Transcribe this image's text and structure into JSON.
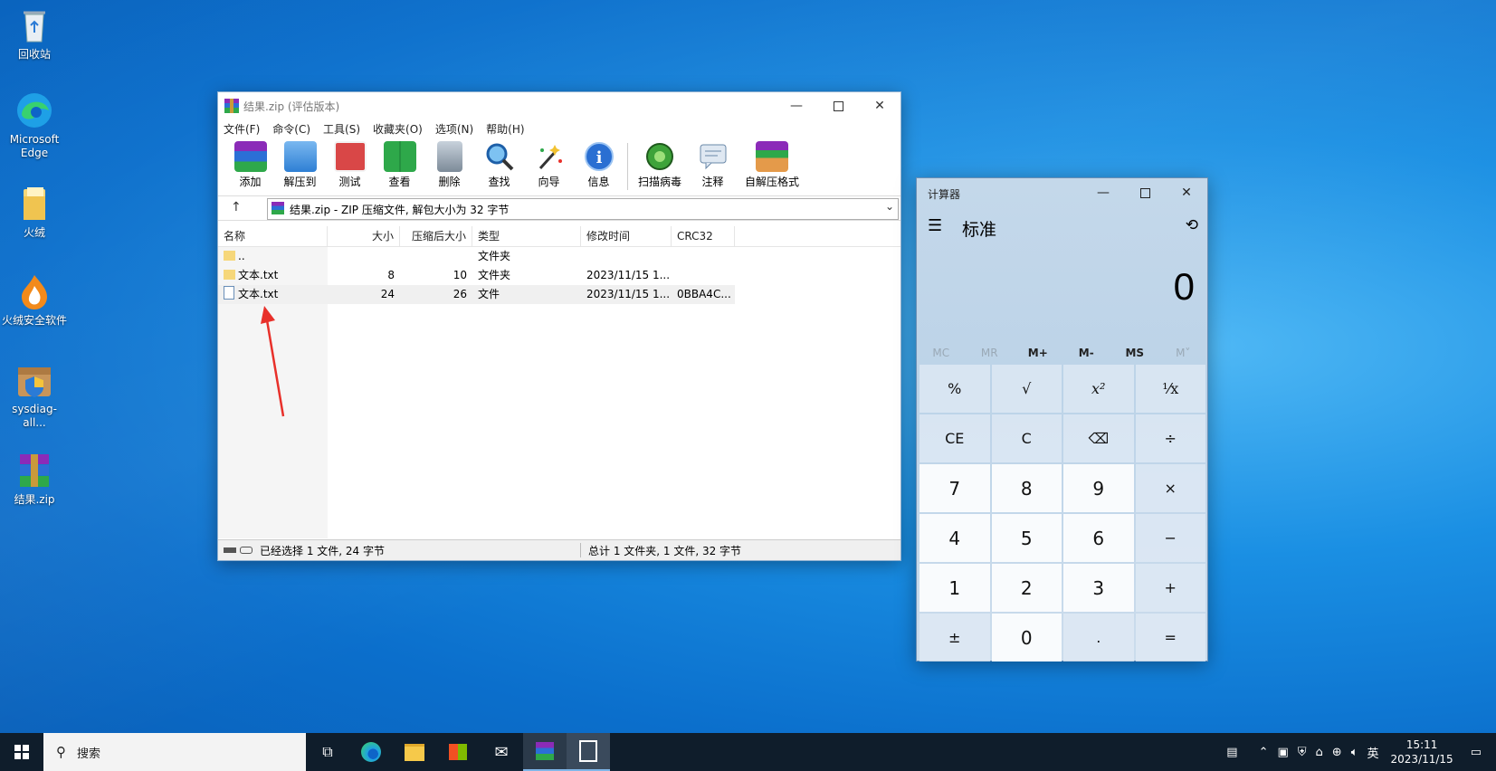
{
  "desktop": {
    "icons": [
      {
        "label": "回收站"
      },
      {
        "label": "Microsoft Edge"
      },
      {
        "label": "火绒"
      },
      {
        "label": "火绒安全软件"
      },
      {
        "label": "sysdiag-all..."
      },
      {
        "label": "结果.zip"
      }
    ]
  },
  "winrar": {
    "title": "结果.zip (评估版本)",
    "menu": [
      "文件(F)",
      "命令(C)",
      "工具(S)",
      "收藏夹(O)",
      "选项(N)",
      "帮助(H)"
    ],
    "toolbar": [
      "添加",
      "解压到",
      "测试",
      "查看",
      "删除",
      "查找",
      "向导",
      "信息",
      "扫描病毒",
      "注释",
      "自解压格式"
    ],
    "address": "结果.zip - ZIP 压缩文件, 解包大小为 32 字节",
    "columns": [
      "名称",
      "大小",
      "压缩后大小",
      "类型",
      "修改时间",
      "CRC32"
    ],
    "rows": [
      {
        "name": "..",
        "size": "",
        "packed": "",
        "type": "文件夹",
        "modified": "",
        "crc": ""
      },
      {
        "name": "文本.txt",
        "size": "8",
        "packed": "10",
        "type": "文件夹",
        "modified": "2023/11/15 1...",
        "crc": ""
      },
      {
        "name": "文本.txt",
        "size": "24",
        "packed": "26",
        "type": "文件",
        "modified": "2023/11/15 1...",
        "crc": "0BBA4C..."
      }
    ],
    "status_left": "已经选择 1 文件, 24 字节",
    "status_right": "总计 1 文件夹, 1 文件, 32 字节"
  },
  "calculator": {
    "title": "计算器",
    "mode": "标准",
    "display": "0",
    "memory": [
      "MC",
      "MR",
      "M+",
      "M-",
      "MS",
      "M˅"
    ],
    "keys": [
      "%",
      "√",
      "x²",
      "¹⁄x",
      "CE",
      "C",
      "⌫",
      "÷",
      "7",
      "8",
      "9",
      "×",
      "4",
      "5",
      "6",
      "−",
      "1",
      "2",
      "3",
      "+",
      "±",
      "0",
      ".",
      "="
    ]
  },
  "taskbar": {
    "search_placeholder": "搜索",
    "time": "15:11",
    "date": "2023/11/15",
    "ime": "英"
  },
  "colors": {
    "accent": "#0b6fcc",
    "arrow": "#e8302a"
  }
}
